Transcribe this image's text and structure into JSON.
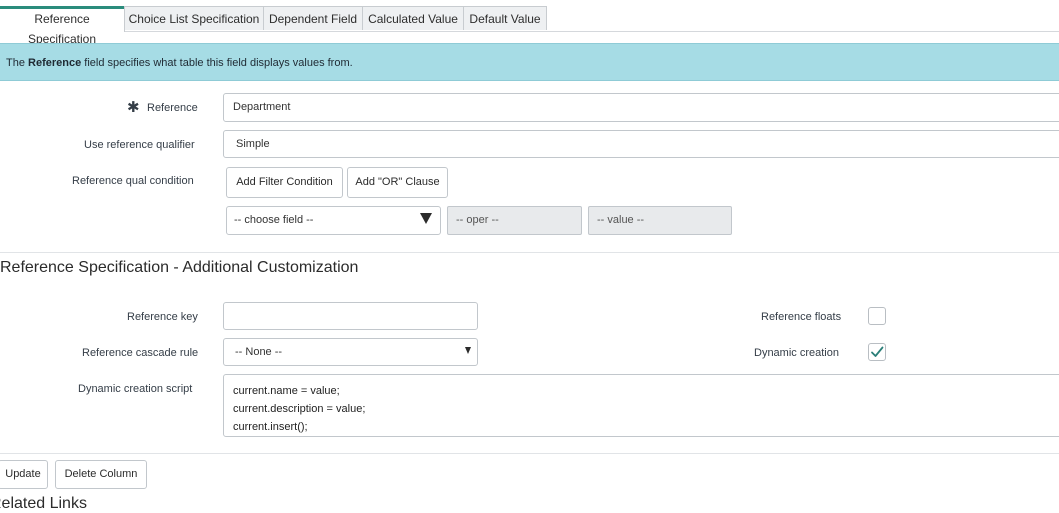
{
  "tabs": [
    {
      "label": "Reference Specification",
      "active": true
    },
    {
      "label": "Choice List Specification",
      "active": false
    },
    {
      "label": "Dependent Field",
      "active": false
    },
    {
      "label": "Calculated Value",
      "active": false
    },
    {
      "label": "Default Value",
      "active": false
    }
  ],
  "info": {
    "prefix": "The ",
    "bold": "Reference",
    "suffix": " field specifies what table this field displays values from."
  },
  "form": {
    "required_mark": "✱",
    "reference_label": "Reference",
    "reference_value": "Department",
    "qualifier_label": "Use reference qualifier",
    "qualifier_value": "Simple",
    "qual_condition_label": "Reference qual condition",
    "add_filter_label": "Add Filter Condition",
    "add_or_label": "Add \"OR\" Clause",
    "choose_field": "-- choose field --",
    "oper": "-- oper --",
    "value": "-- value --"
  },
  "customization": {
    "title": "Reference Specification - Additional Customization",
    "reference_key_label": "Reference key",
    "reference_key_value": "",
    "cascade_label": "Reference cascade rule",
    "cascade_value": "-- None --",
    "script_label": "Dynamic creation script",
    "script_lines": [
      "current.name = value;",
      "current.description = value;",
      "current.insert();"
    ],
    "floats_label": "Reference floats",
    "floats_checked": false,
    "dynamic_label": "Dynamic creation",
    "dynamic_checked": true
  },
  "footer": {
    "update_label": "Update",
    "delete_label": "Delete Column",
    "related_links": "Related Links"
  },
  "colors": {
    "info_bg": "#a6dce5",
    "active_tab_border": "#2a8c7c",
    "check_color": "#2a7f78"
  }
}
